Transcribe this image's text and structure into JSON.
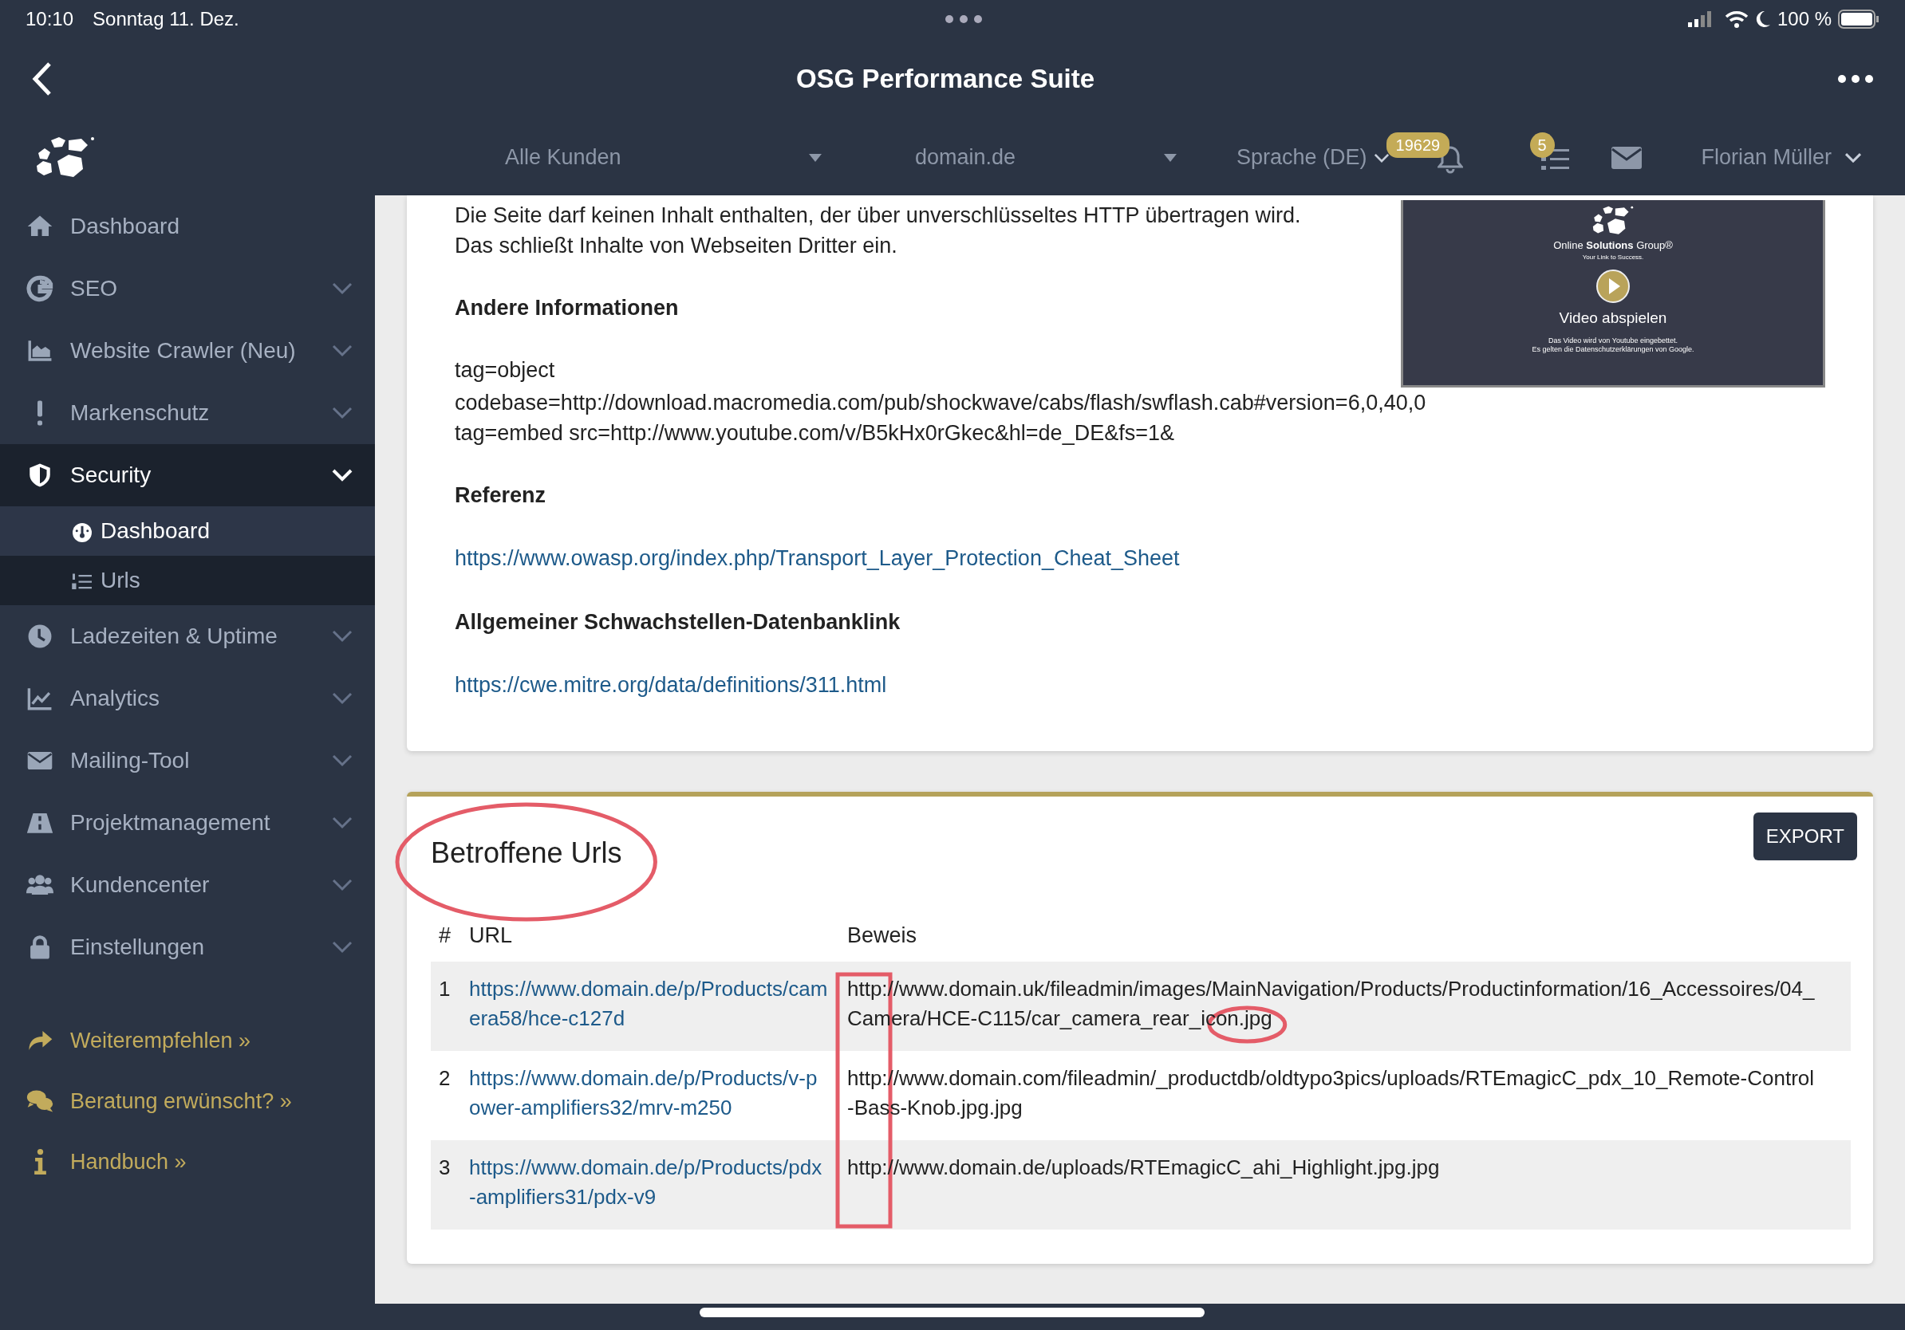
{
  "status_bar": {
    "time": "10:10",
    "date": "Sonntag 11. Dez.",
    "battery_label": "100 %"
  },
  "title_bar": {
    "title": "OSG Performance Suite"
  },
  "header": {
    "customer_select": "Alle Kunden",
    "domain_select": "domain.de",
    "language": "Sprache (DE)",
    "notifications_badge": "19629",
    "tasks_badge": "5",
    "user": "Florian Müller"
  },
  "sidebar": {
    "items": [
      {
        "label": "Dashboard",
        "kind": "link",
        "selected": false
      },
      {
        "label": "SEO",
        "kind": "group",
        "selected": false,
        "expanded": false
      },
      {
        "label": "Website Crawler (Neu)",
        "kind": "group",
        "selected": false,
        "expanded": false
      },
      {
        "label": "Markenschutz",
        "kind": "group",
        "selected": false,
        "expanded": false
      },
      {
        "label": "Security",
        "kind": "group",
        "selected": true,
        "expanded": true,
        "children": [
          {
            "label": "Dashboard",
            "selected": true
          },
          {
            "label": "Urls",
            "selected": false
          }
        ]
      },
      {
        "label": "Ladezeiten & Uptime",
        "kind": "group",
        "selected": false,
        "expanded": false
      },
      {
        "label": "Analytics",
        "kind": "group",
        "selected": false,
        "expanded": false
      },
      {
        "label": "Mailing-Tool",
        "kind": "group",
        "selected": false,
        "expanded": false
      },
      {
        "label": "Projektmanagement",
        "kind": "group",
        "selected": false,
        "expanded": false
      },
      {
        "label": "Kundencenter",
        "kind": "group",
        "selected": false,
        "expanded": false
      },
      {
        "label": "Einstellungen",
        "kind": "group",
        "selected": false,
        "expanded": false
      }
    ],
    "extra_links": [
      {
        "label": "Weiterempfehlen »"
      },
      {
        "label": "Beratung erwünscht? »"
      },
      {
        "label": "Handbuch »"
      }
    ]
  },
  "details": {
    "sections": [
      {
        "kind": "text",
        "lines": [
          "Die Seite darf keinen Inhalt enthalten, der über unverschlüsseltes HTTP übertragen wird.",
          "Das schließt Inhalte von Webseiten Dritter ein."
        ]
      },
      {
        "kind": "heading",
        "text": "Andere Informationen"
      },
      {
        "kind": "text",
        "lines": [
          "tag=object",
          "codebase=http://download.macromedia.com/pub/shockwave/cabs/flash/swflash.cab#version=6,0,40,0",
          "tag=embed src=http://www.youtube.com/v/B5kHx0rGkec&hl=de_DE&fs=1&"
        ]
      },
      {
        "kind": "heading",
        "text": "Referenz"
      },
      {
        "kind": "link",
        "text": "https://www.owasp.org/index.php/Transport_Layer_Protection_Cheat_Sheet"
      },
      {
        "kind": "heading",
        "text": "Allgemeiner Schwachstellen-Datenbanklink"
      },
      {
        "kind": "link",
        "text": "https://cwe.mitre.org/data/definitions/311.html"
      }
    ],
    "video": {
      "brand": "Online **Solutions** Group®",
      "tagline": "Your Link to Success.",
      "play_label": "Video abspielen",
      "notice": [
        "Das Video wird von Youtube eingebettet.",
        "Es gelten die Datenschutzerklärungen von Google."
      ]
    }
  },
  "affected": {
    "title": "Betroffene Urls",
    "export_label": "EXPORT",
    "columns": [
      "#",
      "URL",
      "Beweis"
    ],
    "rows": [
      {
        "index": "1",
        "url": "https://www.domain.de/p/Products/camera58/hce-c127d",
        "evidence": "http://www.domain.uk/fileadmin/images/MainNavigation/Products/Productinformation/16_Accessoires/04_Camera/HCE-C115/car_camera_rear_icon.jpg"
      },
      {
        "index": "2",
        "url": "https://www.domain.de/p/Products/v-power-amplifiers32/mrv-m250",
        "evidence": "http://www.domain.com/fileadmin/_productdb/oldtypo3pics/uploads/RTEmagicC_pdx_10_Remote-Control-Bass-Knob.jpg.jpg"
      },
      {
        "index": "3",
        "url": "https://www.domain.de/p/Products/pdx-amplifiers31/pdx-v9",
        "evidence": "http://www.domain.de/uploads/RTEmagicC_ahi_Highlight.jpg.jpg"
      }
    ]
  }
}
